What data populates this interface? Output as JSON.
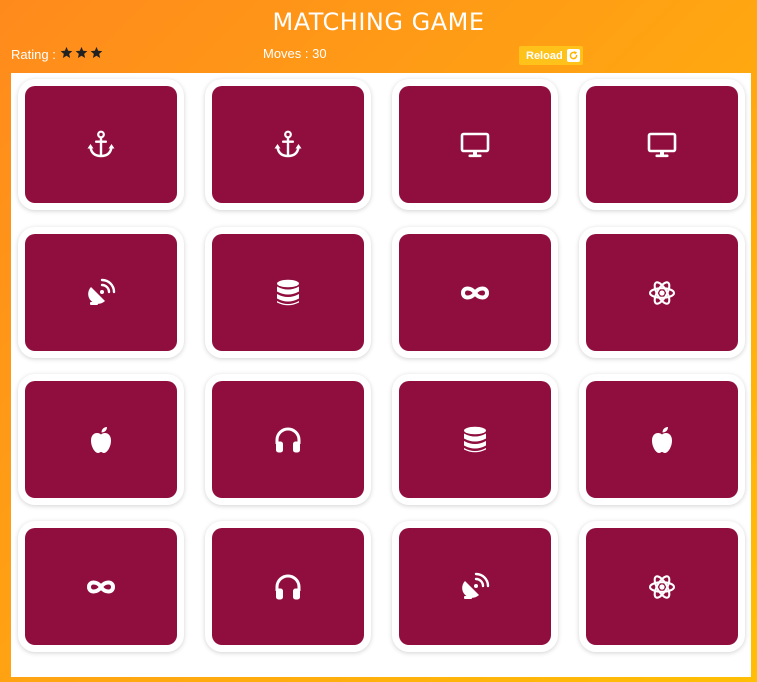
{
  "header": {
    "title": "MATCHING GAME",
    "rating_label": "Rating :",
    "rating_stars": 3,
    "moves_text": "Moves : 30",
    "reload_label": "Reload"
  },
  "colors": {
    "card": "#8f0e3e",
    "reload_button": "#ffc21a"
  },
  "deck": [
    {
      "icon": "anchor-icon"
    },
    {
      "icon": "anchor-icon"
    },
    {
      "icon": "desktop-icon"
    },
    {
      "icon": "desktop-icon"
    },
    {
      "icon": "satellite-dish-icon"
    },
    {
      "icon": "database-icon"
    },
    {
      "icon": "infinity-icon"
    },
    {
      "icon": "atom-icon"
    },
    {
      "icon": "apple-icon"
    },
    {
      "icon": "headphones-icon"
    },
    {
      "icon": "database-icon"
    },
    {
      "icon": "apple-icon"
    },
    {
      "icon": "infinity-icon"
    },
    {
      "icon": "headphones-icon"
    },
    {
      "icon": "satellite-dish-icon"
    },
    {
      "icon": "atom-icon"
    }
  ]
}
